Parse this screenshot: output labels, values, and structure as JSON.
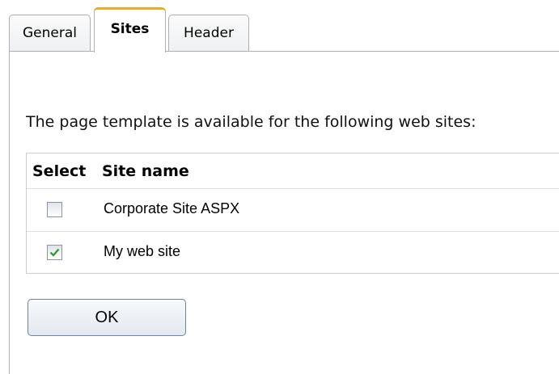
{
  "tabs": [
    {
      "label": "General",
      "selected": false
    },
    {
      "label": "Sites",
      "selected": true
    },
    {
      "label": "Header",
      "selected": false
    }
  ],
  "intro_text": "The page template is available for the following web sites:",
  "grid": {
    "headers": [
      "Select",
      "Site name"
    ],
    "rows": [
      {
        "site_name": "Corporate Site ASPX",
        "selected": false
      },
      {
        "site_name": "My web site",
        "selected": true
      }
    ]
  },
  "buttons": {
    "ok_label": "OK"
  },
  "colors": {
    "active_tab_accent": "#f5a623",
    "checkmark": "#2a9a2a",
    "border": "#a9b0b8"
  }
}
